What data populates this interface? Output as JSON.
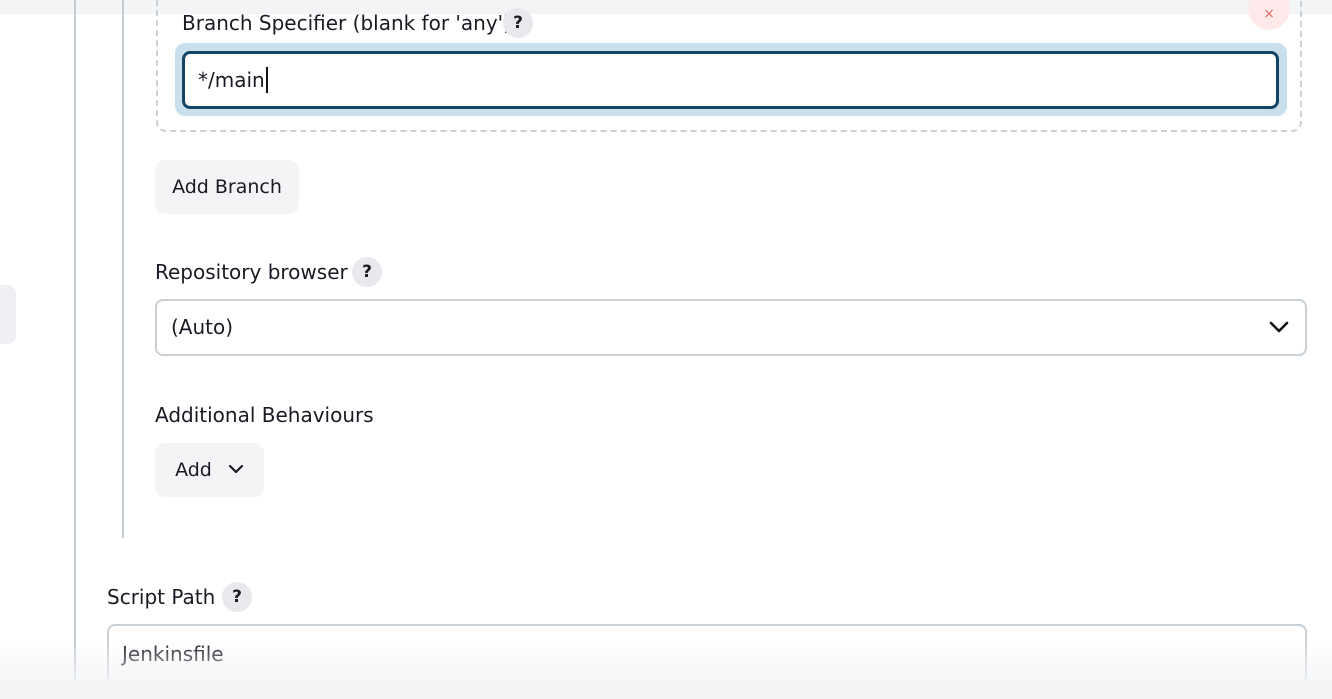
{
  "branch": {
    "specifier_label": "Branch Specifier (blank for 'any')",
    "specifier_value": "*/main",
    "delete_glyph": "×",
    "add_branch_label": "Add Branch"
  },
  "repository_browser": {
    "label": "Repository browser",
    "selected": "(Auto)"
  },
  "additional_behaviours": {
    "label": "Additional Behaviours",
    "add_label": "Add"
  },
  "script_path": {
    "label": "Script Path",
    "value": "Jenkinsfile"
  },
  "help_glyph": "?",
  "icons": {
    "help": "help-icon",
    "chevron": "chevron-down-icon",
    "delete": "close-icon"
  },
  "colors": {
    "focus_ring": "#c9dfec",
    "focus_border": "#154566",
    "delete_bg": "#fde9e9"
  }
}
